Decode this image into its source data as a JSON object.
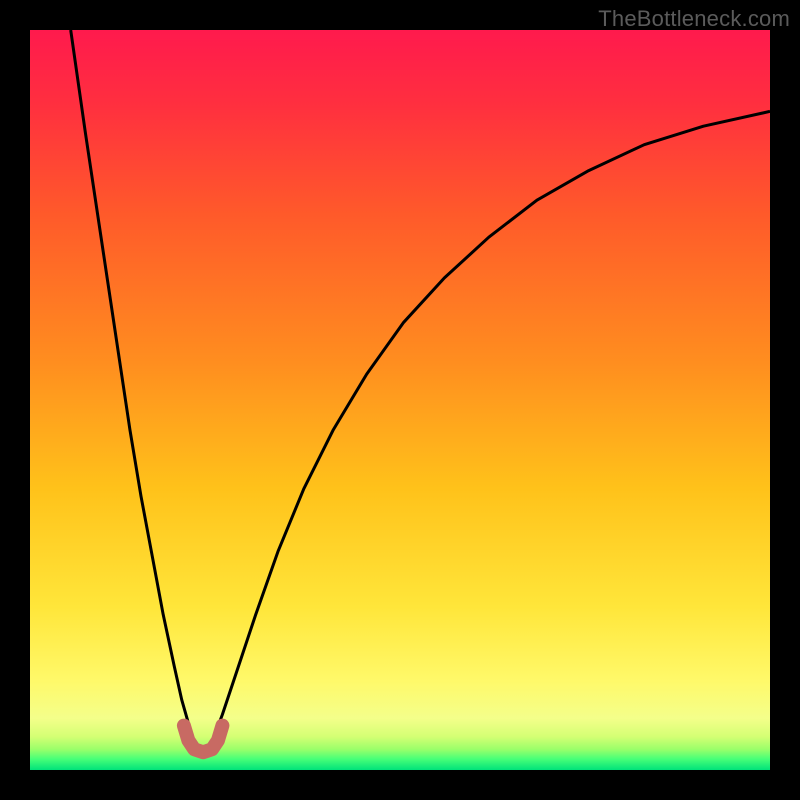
{
  "watermark": "TheBottleneck.com",
  "chart_data": {
    "type": "line",
    "title": "",
    "xlabel": "",
    "ylabel": "",
    "xlim": [
      0,
      1
    ],
    "ylim": [
      0,
      1
    ],
    "grid": false,
    "legend": false,
    "notes": "Background is a vertical gradient from red (top) through orange/yellow to a thin green strip at the bottom, all inside a black border. Two black curves descend from near the top edge to meet near the bottom: the left curve starts at the top-left and dips to a minimum around x≈0.22; the right curve rises toward the top-right. A short desaturated-red U-shaped marker sits at the valley where the curves nearly meet.",
    "background_gradient_stops": [
      {
        "offset": 0.0,
        "color": "#ff1a4d"
      },
      {
        "offset": 0.1,
        "color": "#ff2f3f"
      },
      {
        "offset": 0.25,
        "color": "#ff5a2a"
      },
      {
        "offset": 0.45,
        "color": "#ff8e1f"
      },
      {
        "offset": 0.62,
        "color": "#ffc21a"
      },
      {
        "offset": 0.78,
        "color": "#ffe63a"
      },
      {
        "offset": 0.88,
        "color": "#fff96a"
      },
      {
        "offset": 0.93,
        "color": "#f4ff8a"
      },
      {
        "offset": 0.955,
        "color": "#d4ff74"
      },
      {
        "offset": 0.972,
        "color": "#9aff6a"
      },
      {
        "offset": 0.985,
        "color": "#48ff78"
      },
      {
        "offset": 1.0,
        "color": "#00e27a"
      }
    ],
    "series": [
      {
        "name": "left_curve",
        "stroke": "#000000",
        "stroke_width": 3,
        "x": [
          0.055,
          0.065,
          0.075,
          0.09,
          0.105,
          0.12,
          0.135,
          0.15,
          0.165,
          0.18,
          0.195,
          0.205,
          0.215,
          0.222
        ],
        "y": [
          1.0,
          0.93,
          0.86,
          0.76,
          0.66,
          0.56,
          0.46,
          0.37,
          0.29,
          0.21,
          0.14,
          0.095,
          0.06,
          0.035
        ]
      },
      {
        "name": "right_curve",
        "stroke": "#000000",
        "stroke_width": 3,
        "x": [
          0.245,
          0.26,
          0.28,
          0.305,
          0.335,
          0.37,
          0.41,
          0.455,
          0.505,
          0.56,
          0.62,
          0.685,
          0.755,
          0.83,
          0.91,
          1.0
        ],
        "y": [
          0.035,
          0.075,
          0.135,
          0.21,
          0.295,
          0.38,
          0.46,
          0.535,
          0.605,
          0.665,
          0.72,
          0.77,
          0.81,
          0.845,
          0.87,
          0.89
        ]
      },
      {
        "name": "valley_marker",
        "stroke": "#c86a63",
        "stroke_width": 14,
        "linecap": "round",
        "x": [
          0.208,
          0.214,
          0.222,
          0.234,
          0.246,
          0.254,
          0.26
        ],
        "y": [
          0.06,
          0.04,
          0.028,
          0.024,
          0.028,
          0.04,
          0.06
        ]
      }
    ]
  }
}
